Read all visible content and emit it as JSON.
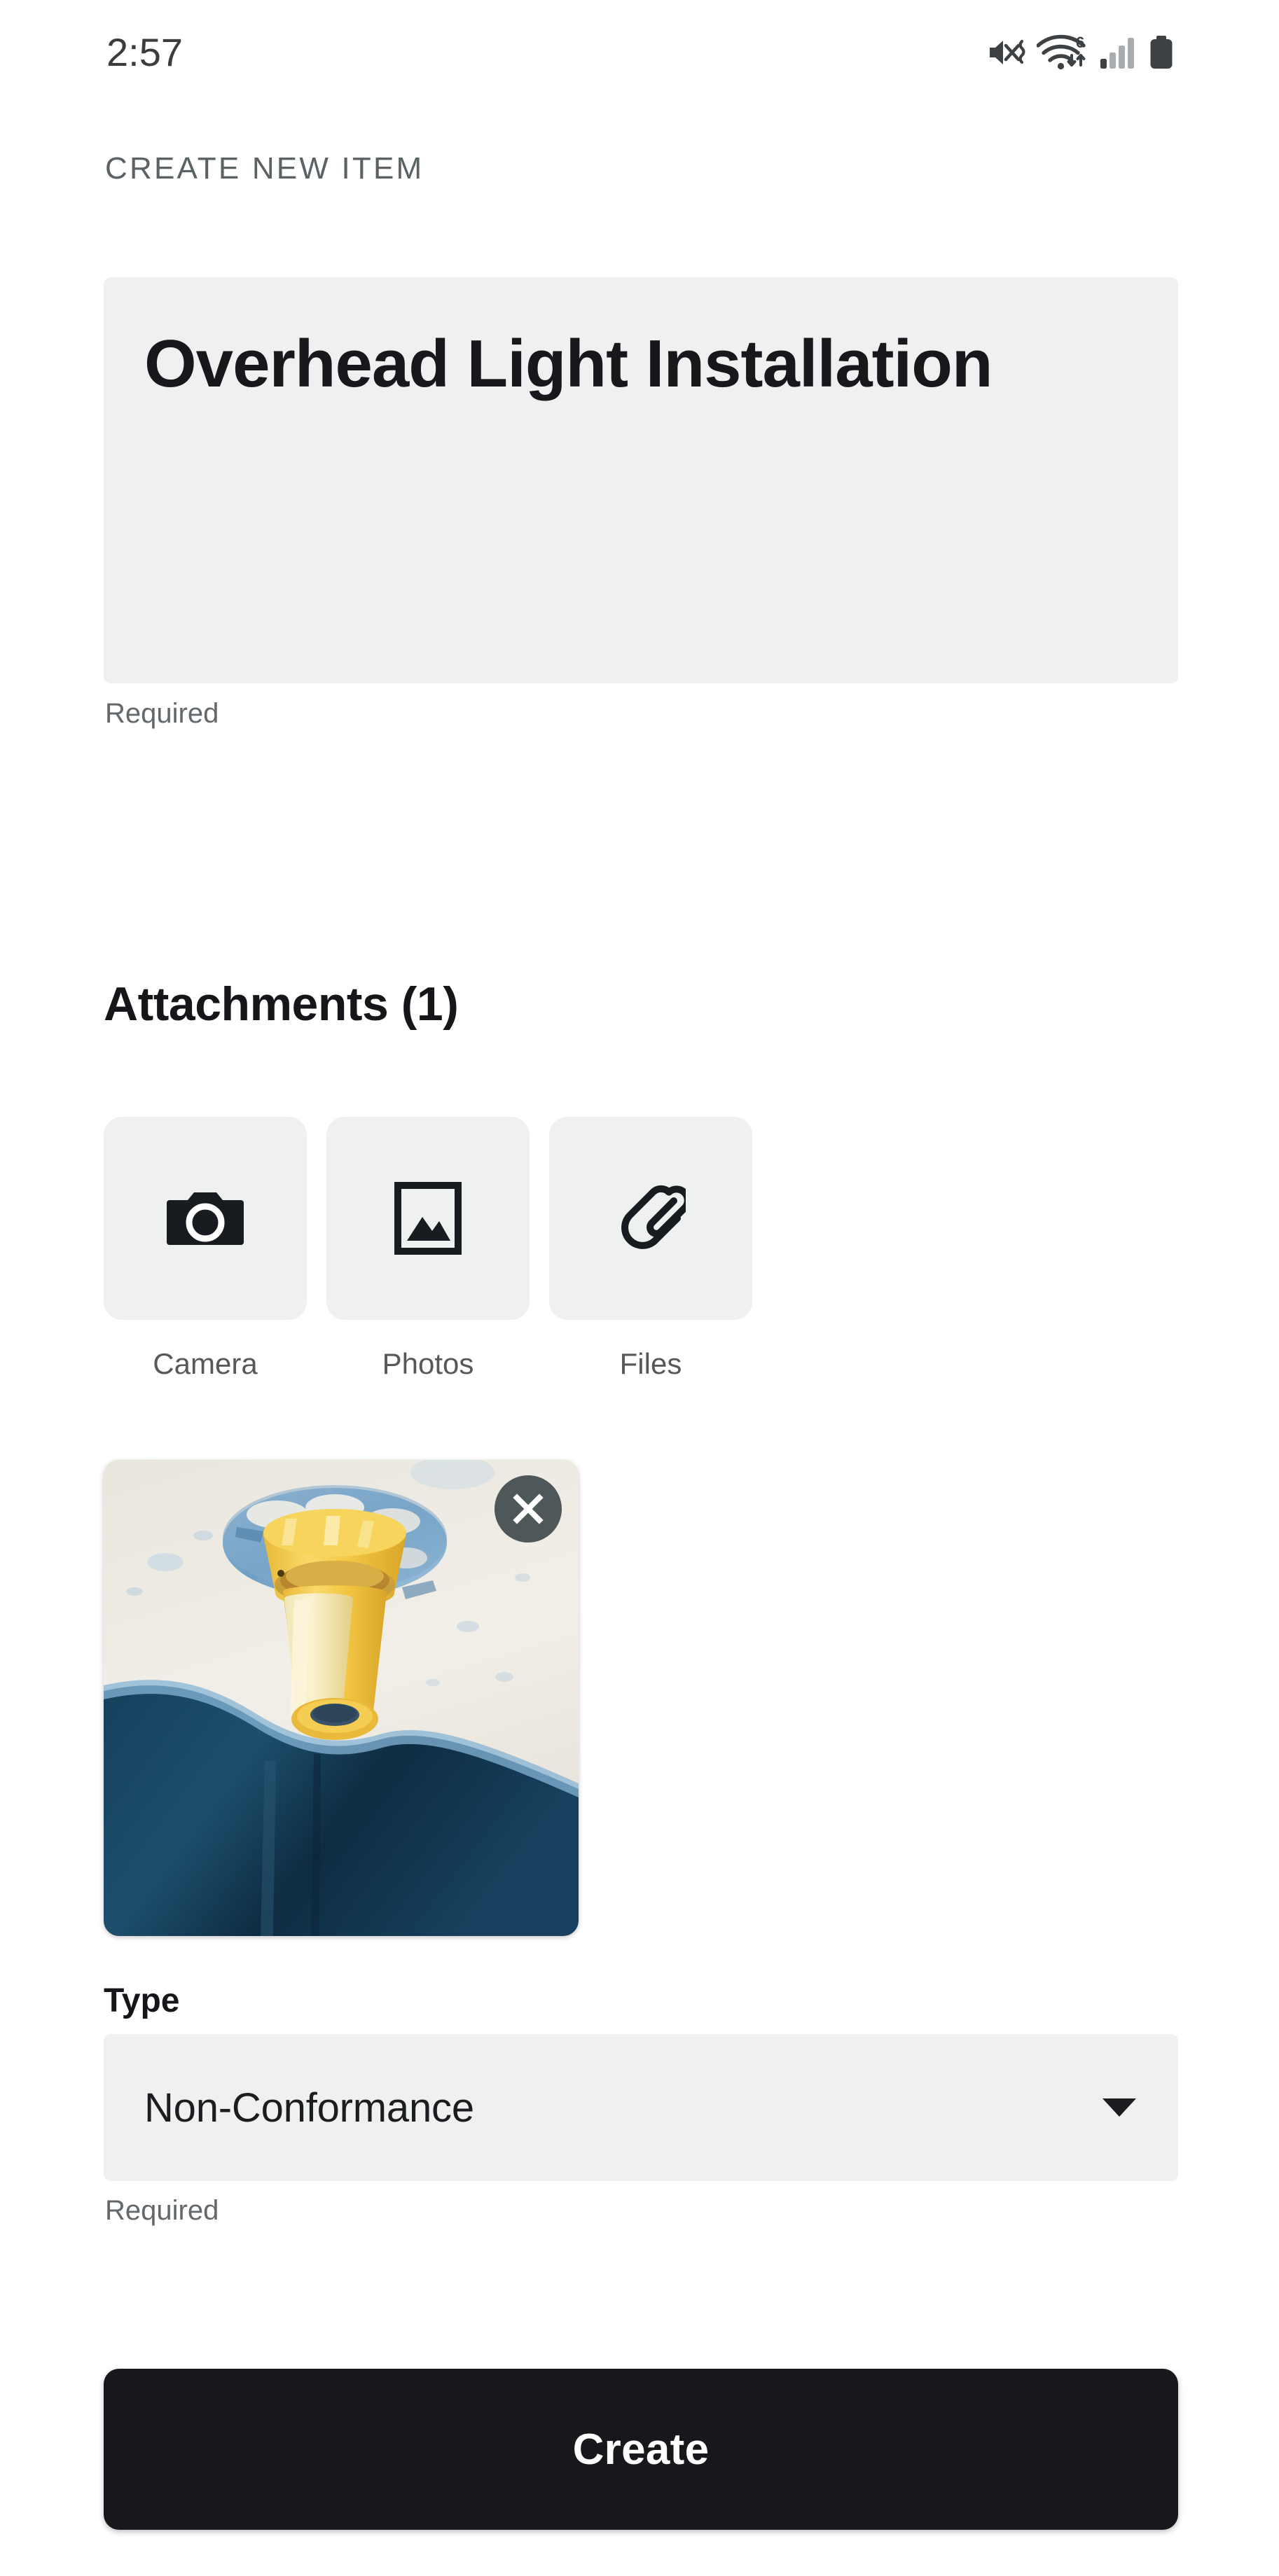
{
  "status_bar": {
    "time": "2:57",
    "icons": [
      {
        "name": "volume-mute-vibrate-icon"
      },
      {
        "name": "wifi-6-icon",
        "badge": "6"
      },
      {
        "name": "cellular-signal-icon"
      },
      {
        "name": "battery-icon"
      }
    ]
  },
  "header": {
    "screen_title": "CREATE NEW ITEM"
  },
  "title_field": {
    "value": "Overhead Light Installation",
    "placeholder": "",
    "helper_text": "Required"
  },
  "attachments": {
    "heading": "Attachments (1)",
    "count": 1,
    "sources": [
      {
        "label": "Camera",
        "icon": "camera-icon"
      },
      {
        "label": "Photos",
        "icon": "image-icon"
      },
      {
        "label": "Files",
        "icon": "paperclip-icon"
      }
    ],
    "items": [
      {
        "alt": "Photo of yellow light fixture mount against blue and cream ceiling",
        "remove_icon": "close-icon"
      }
    ]
  },
  "type_field": {
    "label": "Type",
    "value": "Non-Conformance",
    "helper_text": "Required",
    "caret_icon": "chevron-down-icon"
  },
  "actions": {
    "create_label": "Create"
  },
  "colors": {
    "field_bg": "#eff0f0",
    "primary_button": "#16181c",
    "text_primary": "#14161a",
    "text_muted": "#62686c",
    "remove_badge": "#4e5759"
  }
}
